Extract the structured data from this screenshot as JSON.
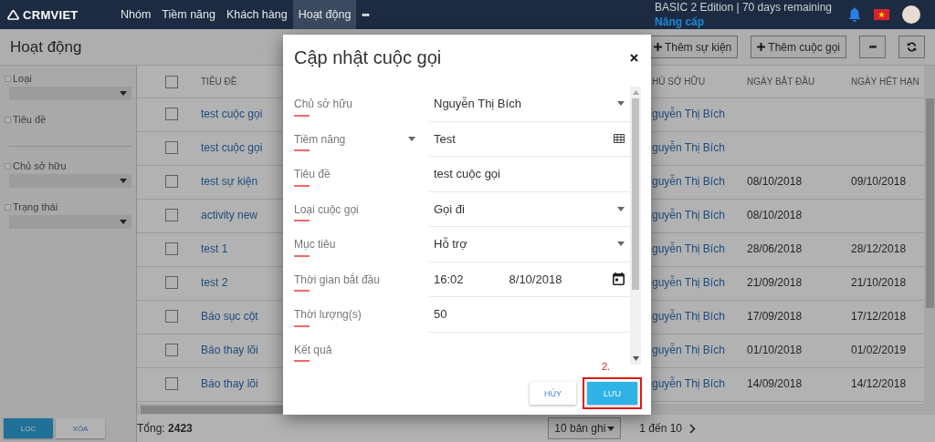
{
  "navbar": {
    "logo": "CRMVIET",
    "items": [
      {
        "label": "Nhóm",
        "selected": false
      },
      {
        "label": "Tiềm năng",
        "selected": false
      },
      {
        "label": "Khách hàng",
        "selected": false
      },
      {
        "label": "Hoạt động",
        "selected": true
      }
    ],
    "more": "•••",
    "edition": "BASIC 2 Edition | 70 days remaining",
    "upgrade": "Nâng cấp"
  },
  "page": {
    "title": "Hoạt động",
    "actions": [
      {
        "kind": "add",
        "label": "Thêm sự kiện"
      },
      {
        "kind": "add",
        "label": "Thêm cuộc gọi"
      },
      {
        "kind": "more",
        "label": "•••"
      },
      {
        "kind": "refresh"
      }
    ]
  },
  "filters": [
    {
      "kind": "select",
      "label": "Loại",
      "checked": false
    },
    {
      "kind": "text",
      "label": "Tiêu đề",
      "checked": false
    },
    {
      "kind": "select",
      "label": "Chủ sở hữu",
      "checked": false
    },
    {
      "kind": "select",
      "label": "Trạng thái",
      "checked": false
    }
  ],
  "filter_buttons": [
    {
      "kind": "primary",
      "label": "LỌC"
    },
    {
      "kind": "secondary",
      "label": "XÓA"
    }
  ],
  "table": {
    "all_checked": false,
    "columns": [
      "TIÊU ĐỀ",
      "HỦ SỞ HỮU",
      "NGÀY BẮT ĐẦU",
      "NGÀY HẾT HẠN"
    ],
    "rows": [
      {
        "checked": false,
        "title": "test cuộc gọi",
        "owner": "guyễn Thị Bích",
        "start": "",
        "end": ""
      },
      {
        "checked": false,
        "title": "test cuộc gọi",
        "owner": "guyễn Thị Bích",
        "start": "",
        "end": ""
      },
      {
        "checked": false,
        "title": "test sự kiện",
        "owner": "guyễn Thị Bích",
        "start": "08/10/2018",
        "end": "09/10/2018"
      },
      {
        "checked": false,
        "title": "activity new",
        "owner": "guyễn Thị Bích",
        "start": "08/10/2018",
        "end": ""
      },
      {
        "checked": false,
        "title": "test 1",
        "owner": "guyễn Thị Bích",
        "start": "28/06/2018",
        "end": "28/12/2018"
      },
      {
        "checked": false,
        "title": "test 2",
        "owner": "guyễn Thị Bích",
        "start": "21/09/2018",
        "end": "21/10/2018"
      },
      {
        "checked": false,
        "title": "Báo sục cột",
        "owner": "guyễn Thị Bích",
        "start": "17/09/2018",
        "end": "17/12/2018"
      },
      {
        "checked": false,
        "title": "Báo thay lõi",
        "owner": "guyễn Thị Bích",
        "start": "01/10/2018",
        "end": "01/02/2019"
      },
      {
        "checked": false,
        "title": "Báo thay lõi",
        "owner": "guyễn Thị Bích",
        "start": "14/09/2018",
        "end": "14/12/2018"
      }
    ]
  },
  "footer": {
    "total_label": "Tổng:",
    "total": "2423",
    "page_size": "10 bản ghi",
    "range": "1 đến 10"
  },
  "dialog": {
    "title": "Cập nhật cuộc gọi",
    "fields": [
      {
        "kind": "select",
        "label": "Chủ sở hữu",
        "value": "Nguyễn Thị Bích"
      },
      {
        "kind": "lookup",
        "label": "Tiềm năng",
        "value": "Test"
      },
      {
        "kind": "text",
        "label": "Tiêu đề",
        "value": "test cuộc gọi"
      },
      {
        "kind": "select",
        "label": "Loại cuộc gọi",
        "value": "Gọi đi"
      },
      {
        "kind": "select",
        "label": "Mục tiêu",
        "value": "Hỗ trợ"
      },
      {
        "kind": "datetime",
        "label": "Thời gian bắt đầu",
        "time": "16:02",
        "date": "8/10/2018"
      },
      {
        "kind": "text",
        "label": "Thời lượng(s)",
        "value": "50"
      },
      {
        "kind": "text",
        "label": "Kết quả"
      }
    ],
    "annotation": "2.",
    "buttons": [
      {
        "kind": "secondary",
        "label": "HỦY",
        "highlighted": false
      },
      {
        "kind": "primary",
        "label": "LƯU",
        "highlighted": true
      }
    ]
  }
}
